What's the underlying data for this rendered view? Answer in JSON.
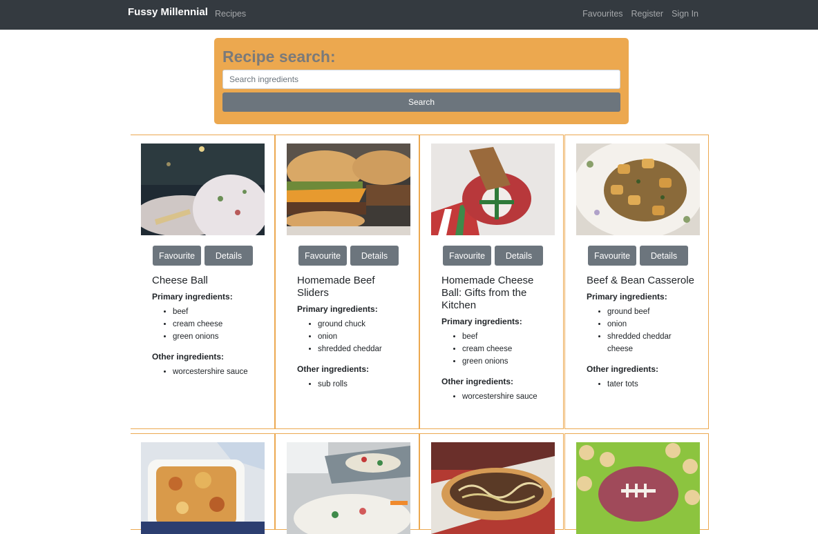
{
  "nav": {
    "brand": "Fussy Millennial",
    "recipes": "Recipes",
    "favourites": "Favourites",
    "register": "Register",
    "sign_in": "Sign In"
  },
  "search": {
    "title": "Recipe search:",
    "placeholder": "Search ingredients",
    "value": "",
    "button": "Search"
  },
  "card_buttons": {
    "favourite": "Favourite",
    "details": "Details"
  },
  "labels": {
    "primary": "Primary ingredients:",
    "other": "Other ingredients:"
  },
  "recipes": [
    {
      "title": "Cheese Ball",
      "primary": [
        "beef",
        "cream cheese",
        "green onions"
      ],
      "other": [
        "worcestershire sauce"
      ]
    },
    {
      "title": "Homemade Beef Sliders",
      "primary": [
        "ground chuck",
        "onion",
        "shredded cheddar"
      ],
      "other": [
        "sub rolls"
      ]
    },
    {
      "title": "Homemade Cheese Ball: Gifts from the Kitchen",
      "primary": [
        "beef",
        "cream cheese",
        "green onions"
      ],
      "other": [
        "worcestershire sauce"
      ]
    },
    {
      "title": "Beef & Bean Casserole",
      "primary": [
        "ground beef",
        "onion",
        "shredded cheddar cheese"
      ],
      "other": [
        "tater tots"
      ]
    }
  ],
  "colors": {
    "navbar": "#343a40",
    "accent": "#eca84f",
    "button": "#6c757d"
  }
}
